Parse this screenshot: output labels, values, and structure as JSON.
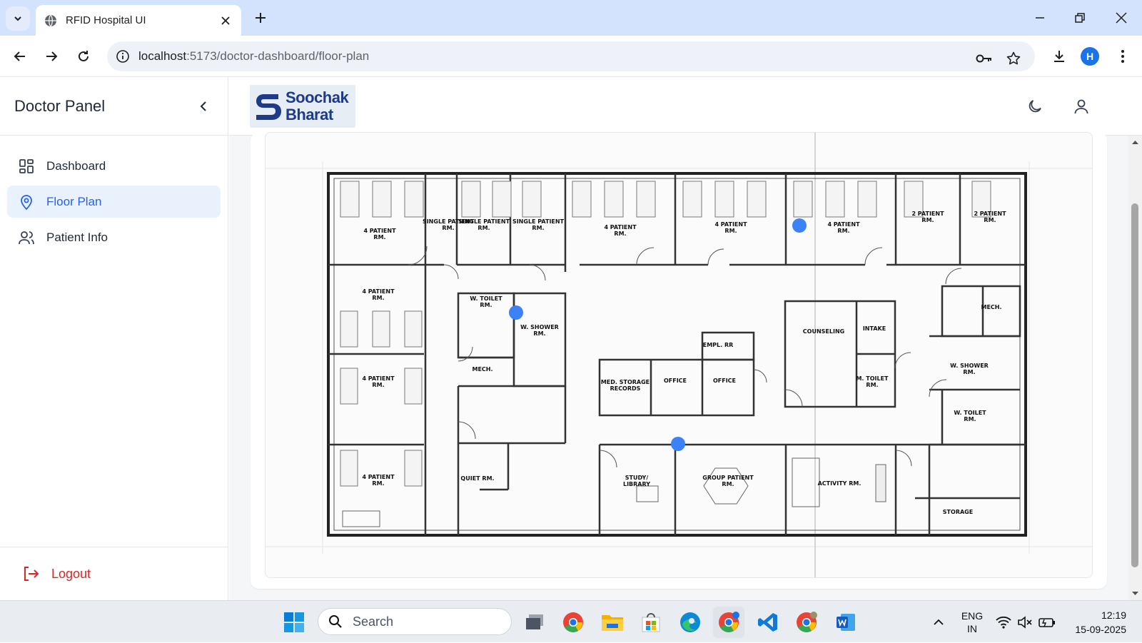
{
  "browser": {
    "tab_title": "RFID Hospital UI",
    "url_host": "localhost",
    "url_path": ":5173/doctor-dashboard/floor-plan",
    "profile_initial": "H"
  },
  "sidebar": {
    "title": "Doctor Panel",
    "items": [
      {
        "label": "Dashboard",
        "icon": "grid-icon"
      },
      {
        "label": "Floor Plan",
        "icon": "map-pin-icon",
        "active": true
      },
      {
        "label": "Patient Info",
        "icon": "users-icon"
      }
    ],
    "logout_label": "Logout"
  },
  "header": {
    "logo_line1": "Soochak",
    "logo_line2": "Bharat"
  },
  "floor_plan": {
    "rooms": [
      "4 PATIENT RM.",
      "SINGLE PATIENT RM.",
      "SINGLE PATIENT RM.",
      "SINGLE PATIENT RM.",
      "4 PATIENT RM.",
      "4 PATIENT RM.",
      "4 PATIENT RM.",
      "2 PATIENT RM.",
      "2 PATIENT RM.",
      "4 PATIENT RM.",
      "W. TOILET RM.",
      "W. SHOWER RM.",
      "MECH.",
      "EMPL. RR",
      "COUNSELING",
      "INTAKE",
      "MECH.",
      "W. SHOWER RM.",
      "4 PATIENT RM.",
      "MED. STORAGE RECORDS",
      "OFFICE",
      "OFFICE",
      "M. TOILET RM.",
      "W. TOILET RM.",
      "4 PATIENT RM.",
      "QUIET RM.",
      "STUDY/ LIBRARY",
      "GROUP PATIENT RM.",
      "ACTIVITY RM.",
      "STORAGE"
    ],
    "marker_color": "#3b82f6",
    "marker_count": 3
  },
  "taskbar": {
    "search_placeholder": "Search",
    "lang_line1": "ENG",
    "lang_line2": "IN",
    "time": "12:19",
    "date": "15-09-2025"
  },
  "colors": {
    "accent": "#2563eb",
    "logout": "#dc2626",
    "tabbar": "#d3e3fd"
  }
}
